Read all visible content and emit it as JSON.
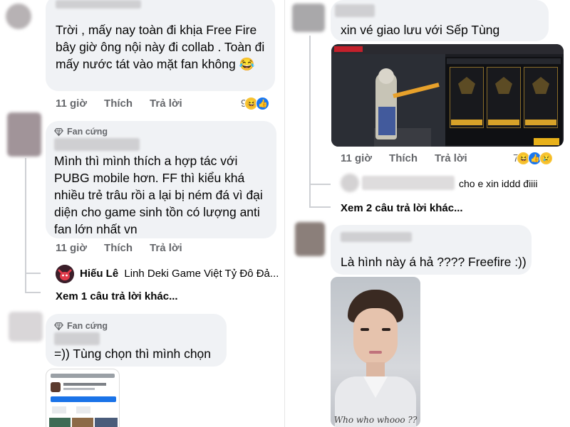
{
  "left": {
    "c1": {
      "text": "Trời , mấy nay toàn đi khịa Free Fire bây giờ ông nội này đi collab . Toàn đi mấy nước tát vào mặt fan không 😂",
      "actions": {
        "time": "11 giờ",
        "like": "Thích",
        "reply": "Trả lời"
      },
      "reaction_count": "9"
    },
    "c2": {
      "badge": "Fan cứng",
      "text": "Mình thì mình thích a hợp tác với PUBG mobile hơn. FF thì kiểu khá nhiều trẻ trâu rồi a lại bị ném đá vì đại diện cho game sinh tồn có lượng anti fan lớn nhất vn",
      "actions": {
        "time": "11 giờ",
        "like": "Thích",
        "reply": "Trả lời"
      },
      "reply_preview": {
        "name": "Hiếu Lê",
        "text": "Linh Deki Game Việt Tỷ Đô Đả..."
      },
      "more_replies": "Xem 1 câu trả lời khác..."
    },
    "c3": {
      "badge": "Fan cứng",
      "text": "=)) Tùng chọn thì mình chọn"
    }
  },
  "right": {
    "c1": {
      "text": "xin vé giao lưu với Sếp Tùng",
      "actions": {
        "time": "11 giờ",
        "like": "Thích",
        "reply": "Trả lời"
      },
      "reaction_count": "7"
    },
    "reply1": {
      "text": "cho e xin iddd điiii"
    },
    "more_replies": "Xem 2 câu trả lời khác...",
    "c2": {
      "text": "Là hình này á hả ???? Freefire :))",
      "portrait_caption": "Who who whooo ??"
    }
  },
  "colors": {
    "bubble": "#f0f2f5",
    "secondary_text": "#65676b",
    "like_blue": "#1877f2",
    "haha_yellow": "#f7c433"
  }
}
